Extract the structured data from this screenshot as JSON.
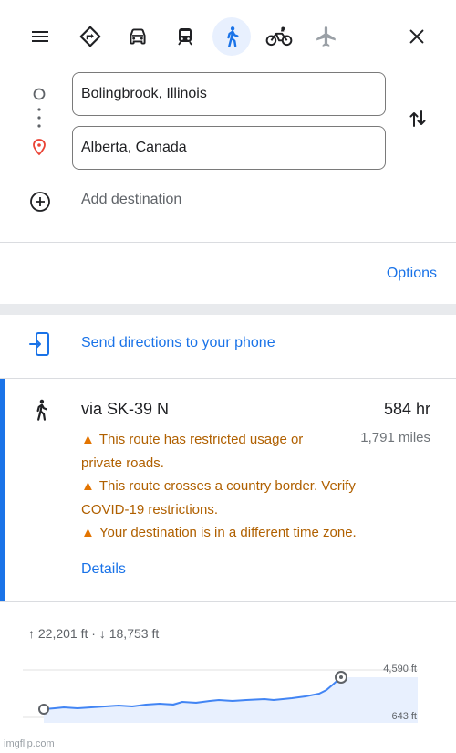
{
  "toolbar": {
    "icons": [
      "menu-icon",
      "directions-icon",
      "car-icon",
      "transit-icon",
      "walk-icon",
      "bike-icon",
      "flight-icon",
      "close-icon"
    ],
    "active_mode": "walk",
    "accent": "#1a73e8"
  },
  "origin": {
    "value": "Bolingbrook, Illinois"
  },
  "destination": {
    "value": "Alberta, Canada"
  },
  "add_destination": "Add destination",
  "options_label": "Options",
  "send_directions": "Send directions to your phone",
  "route": {
    "title": "via SK-39 N",
    "time": "584 hr",
    "distance": "1,791 miles",
    "warnings": [
      {
        "line1": "This route has restricted usage or",
        "line2": "private roads."
      },
      {
        "line1": "This route crosses a country border. Verify",
        "line2": "COVID-19 restrictions."
      },
      {
        "line1": "Your destination is in a different time zone."
      }
    ],
    "details_label": "Details",
    "warning_color": "#b06000"
  },
  "elevation": {
    "ascent": "22,201 ft",
    "descent": "18,753 ft",
    "max_label": "4,590 ft",
    "min_label": "643 ft"
  },
  "watermark": "imgflip.com"
}
